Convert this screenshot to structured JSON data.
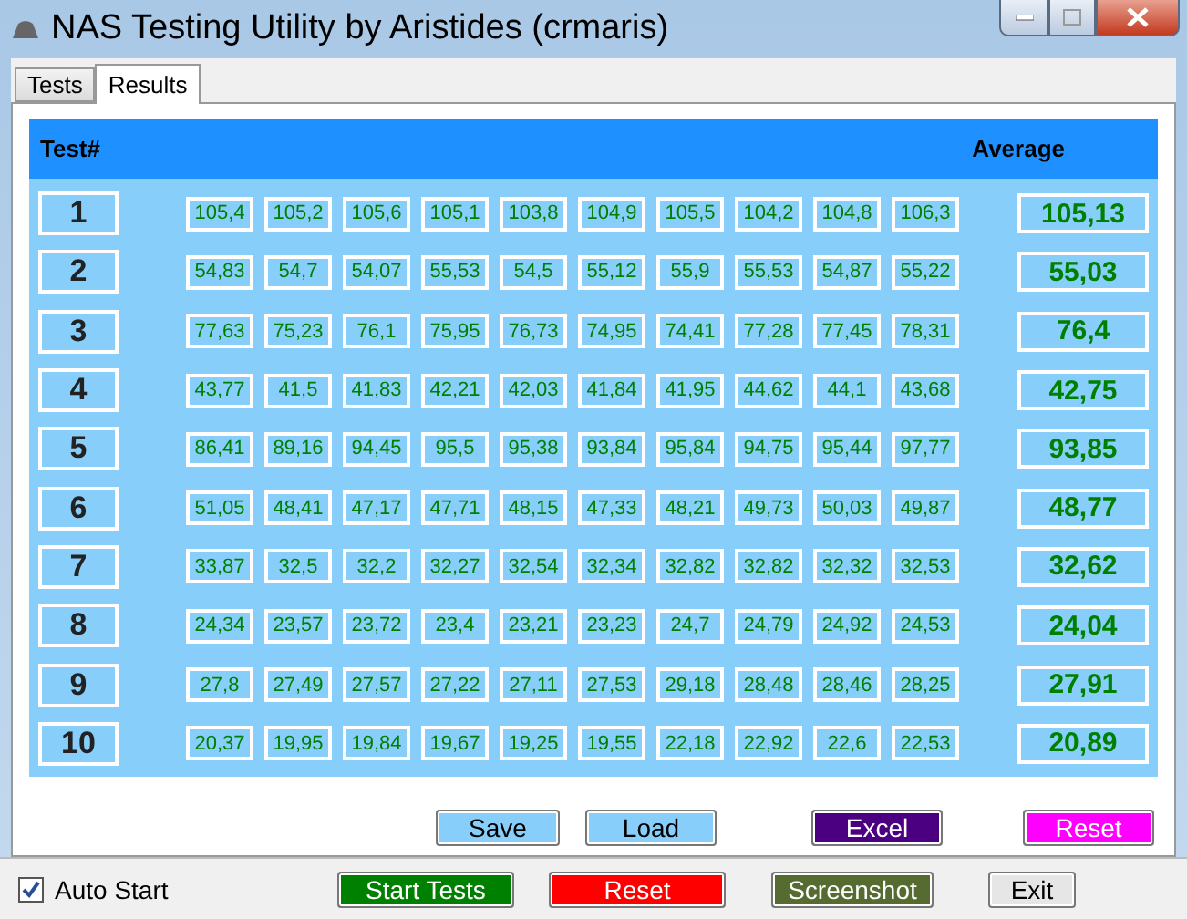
{
  "window": {
    "title": "NAS Testing Utility by Aristides (crmaris)"
  },
  "tabs": [
    {
      "label": "Tests",
      "selected": false
    },
    {
      "label": "Results",
      "selected": true
    }
  ],
  "table": {
    "columns": [
      "Test#",
      "Average"
    ],
    "rows": [
      {
        "label": "1",
        "values": [
          "105,4",
          "105,2",
          "105,6",
          "105,1",
          "103,8",
          "104,9",
          "105,5",
          "104,2",
          "104,8",
          "106,3"
        ],
        "average": "105,13"
      },
      {
        "label": "2",
        "values": [
          "54,83",
          "54,7",
          "54,07",
          "55,53",
          "54,5",
          "55,12",
          "55,9",
          "55,53",
          "54,87",
          "55,22"
        ],
        "average": "55,03"
      },
      {
        "label": "3",
        "values": [
          "77,63",
          "75,23",
          "76,1",
          "75,95",
          "76,73",
          "74,95",
          "74,41",
          "77,28",
          "77,45",
          "78,31"
        ],
        "average": "76,4"
      },
      {
        "label": "4",
        "values": [
          "43,77",
          "41,5",
          "41,83",
          "42,21",
          "42,03",
          "41,84",
          "41,95",
          "44,62",
          "44,1",
          "43,68"
        ],
        "average": "42,75"
      },
      {
        "label": "5",
        "values": [
          "86,41",
          "89,16",
          "94,45",
          "95,5",
          "95,38",
          "93,84",
          "95,84",
          "94,75",
          "95,44",
          "97,77"
        ],
        "average": "93,85"
      },
      {
        "label": "6",
        "values": [
          "51,05",
          "48,41",
          "47,17",
          "47,71",
          "48,15",
          "47,33",
          "48,21",
          "49,73",
          "50,03",
          "49,87"
        ],
        "average": "48,77"
      },
      {
        "label": "7",
        "values": [
          "33,87",
          "32,5",
          "32,2",
          "32,27",
          "32,54",
          "32,34",
          "32,82",
          "32,82",
          "32,32",
          "32,53"
        ],
        "average": "32,62"
      },
      {
        "label": "8",
        "values": [
          "24,34",
          "23,57",
          "23,72",
          "23,4",
          "23,21",
          "23,23",
          "24,7",
          "24,79",
          "24,92",
          "24,53"
        ],
        "average": "24,04"
      },
      {
        "label": "9",
        "values": [
          "27,8",
          "27,49",
          "27,57",
          "27,22",
          "27,11",
          "27,53",
          "29,18",
          "28,48",
          "28,46",
          "28,25"
        ],
        "average": "27,91"
      },
      {
        "label": "10",
        "values": [
          "20,37",
          "19,95",
          "19,84",
          "19,67",
          "19,25",
          "19,55",
          "22,18",
          "22,92",
          "22,6",
          "22,53"
        ],
        "average": "20,89"
      }
    ]
  },
  "result_buttons": [
    {
      "label": "Save",
      "color": "#87cefa"
    },
    {
      "label": "Load",
      "color": "#87cefa"
    },
    {
      "label": "Excel",
      "color": "#4b0082"
    },
    {
      "label": "Reset",
      "color": "#ff00ff"
    }
  ],
  "footer": {
    "auto_start": {
      "label": "Auto Start",
      "checked": true
    },
    "buttons": [
      {
        "label": "Start Tests",
        "color": "#008000"
      },
      {
        "label": "Reset",
        "color": "#ff0000"
      },
      {
        "label": "Screenshot",
        "color": "#556b2f"
      },
      {
        "label": "Exit",
        "color": "#e6e6e6"
      }
    ]
  }
}
